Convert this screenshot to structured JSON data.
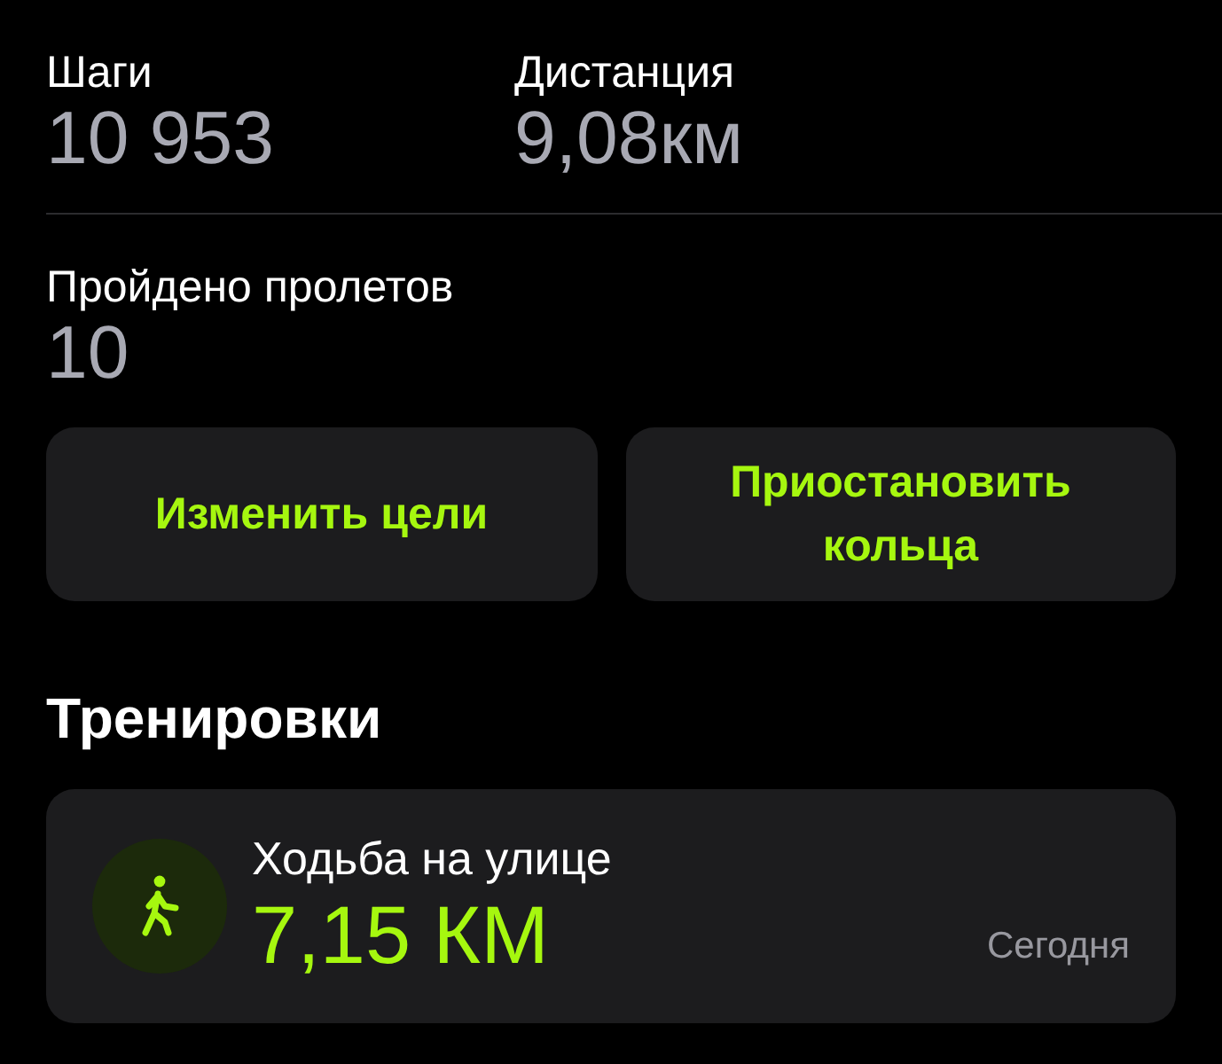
{
  "stats_top": [
    {
      "label": "Шаги",
      "value": "10 953"
    },
    {
      "label": "Дистанция",
      "value": "9,08км"
    }
  ],
  "stats_bottom": [
    {
      "label": "Пройдено пролетов",
      "value": "10"
    }
  ],
  "buttons": [
    "Изменить цели",
    "Приостановить кольца"
  ],
  "workouts": {
    "title": "Тренировки",
    "items": [
      {
        "name": "Ходьба на улице",
        "value": "7,15 КМ",
        "date": "Сегодня"
      }
    ]
  }
}
